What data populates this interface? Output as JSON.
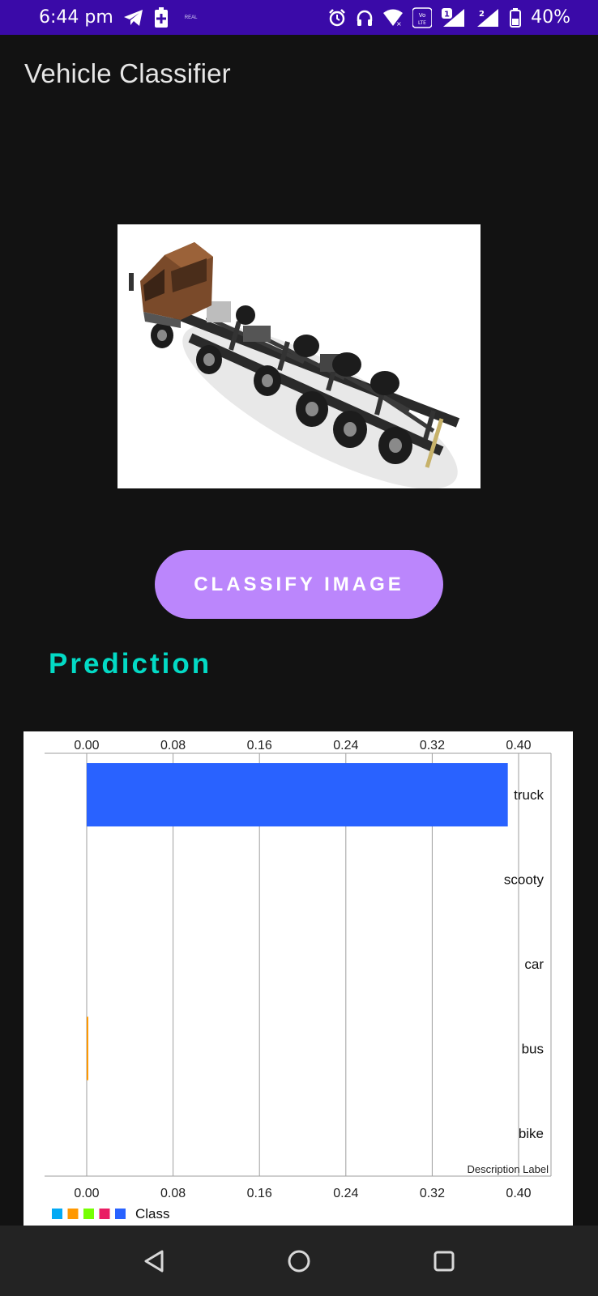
{
  "status_bar": {
    "time": "6:44 pm",
    "battery": "40%",
    "small_note": "REAL",
    "sim1_badge": "1",
    "sim2_badge": "2",
    "volte_label": "VoLTE",
    "icons": [
      "telegram-icon",
      "battery-saver-icon",
      "alarm-icon",
      "headphones-icon",
      "wifi-icon",
      "volte-icon",
      "signal-sim1-icon",
      "signal-sim2-icon",
      "battery-icon"
    ]
  },
  "app": {
    "title": "Vehicle Classifier",
    "image_alt": "truck-chassis-image",
    "classify_button": "CLASSIFY IMAGE",
    "prediction_heading": "Prediction"
  },
  "colors": {
    "status_bar": "#3a0aa8",
    "background": "#121212",
    "button": "#bb86fc",
    "heading": "#03dac5",
    "bar_truck": "#2962ff",
    "bar_bus": "#ff9800"
  },
  "chart_data": {
    "type": "bar",
    "orientation": "horizontal",
    "categories": [
      "truck",
      "scooty",
      "car",
      "bus",
      "bike"
    ],
    "series": [
      {
        "name": "Class",
        "values": [
          0.39,
          0.0,
          0.0,
          0.001,
          0.0
        ],
        "colors": [
          "#2962ff",
          "#e91e63",
          "#76ff03",
          "#ff9800",
          "#03a9f4"
        ]
      }
    ],
    "xlim": [
      0,
      0.4
    ],
    "x_ticks": [
      "0.00",
      "0.08",
      "0.16",
      "0.24",
      "0.32",
      "0.40"
    ],
    "x_tick_values": [
      0,
      0.08,
      0.16,
      0.24,
      0.32,
      0.4
    ],
    "description": "Description Label",
    "grid": true,
    "legend": {
      "placement": "bottom-left",
      "label": "Class",
      "swatches": [
        "#03a9f4",
        "#ff9800",
        "#76ff03",
        "#e91e63",
        "#2962ff"
      ]
    }
  },
  "nav_bar": {
    "icons": [
      "back-icon",
      "home-icon",
      "recents-icon"
    ]
  }
}
